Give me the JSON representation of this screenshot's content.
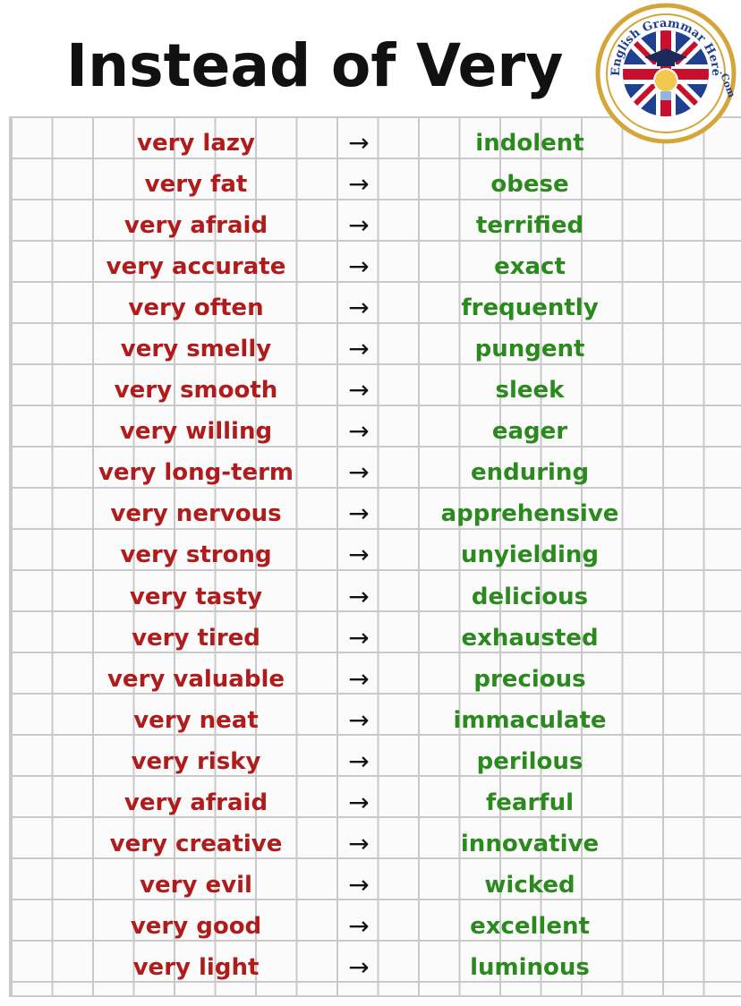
{
  "title": "Instead of Very",
  "logo": {
    "text_top": "English Grammar Here",
    "text_right": ".Com",
    "icon": "uk-flag-graduate-lightbulb-icon"
  },
  "arrow_symbol": "→",
  "colors": {
    "original_word": "#b01c1c",
    "replacement_word": "#2b8a1e",
    "title": "#111111",
    "grid_line": "#c9c9c9",
    "logo_ring": "#d4a63a"
  },
  "pairs": [
    {
      "from": "very lazy",
      "to": "indolent"
    },
    {
      "from": "very fat",
      "to": "obese"
    },
    {
      "from": "very afraid",
      "to": "terrified"
    },
    {
      "from": "very accurate",
      "to": "exact"
    },
    {
      "from": "very often",
      "to": "frequently"
    },
    {
      "from": "very smelly",
      "to": "pungent"
    },
    {
      "from": "very smooth",
      "to": "sleek"
    },
    {
      "from": "very willing",
      "to": "eager"
    },
    {
      "from": "very long-term",
      "to": "enduring"
    },
    {
      "from": "very nervous",
      "to": "apprehensive"
    },
    {
      "from": "very strong",
      "to": "unyielding"
    },
    {
      "from": "very tasty",
      "to": "delicious"
    },
    {
      "from": "very tired",
      "to": "exhausted"
    },
    {
      "from": "very valuable",
      "to": "precious"
    },
    {
      "from": "very neat",
      "to": "immaculate"
    },
    {
      "from": "very risky",
      "to": "perilous"
    },
    {
      "from": "very afraid",
      "to": "fearful"
    },
    {
      "from": "very creative",
      "to": "innovative"
    },
    {
      "from": "very evil",
      "to": "wicked"
    },
    {
      "from": "very good",
      "to": "excellent"
    },
    {
      "from": "very light",
      "to": "luminous"
    }
  ]
}
